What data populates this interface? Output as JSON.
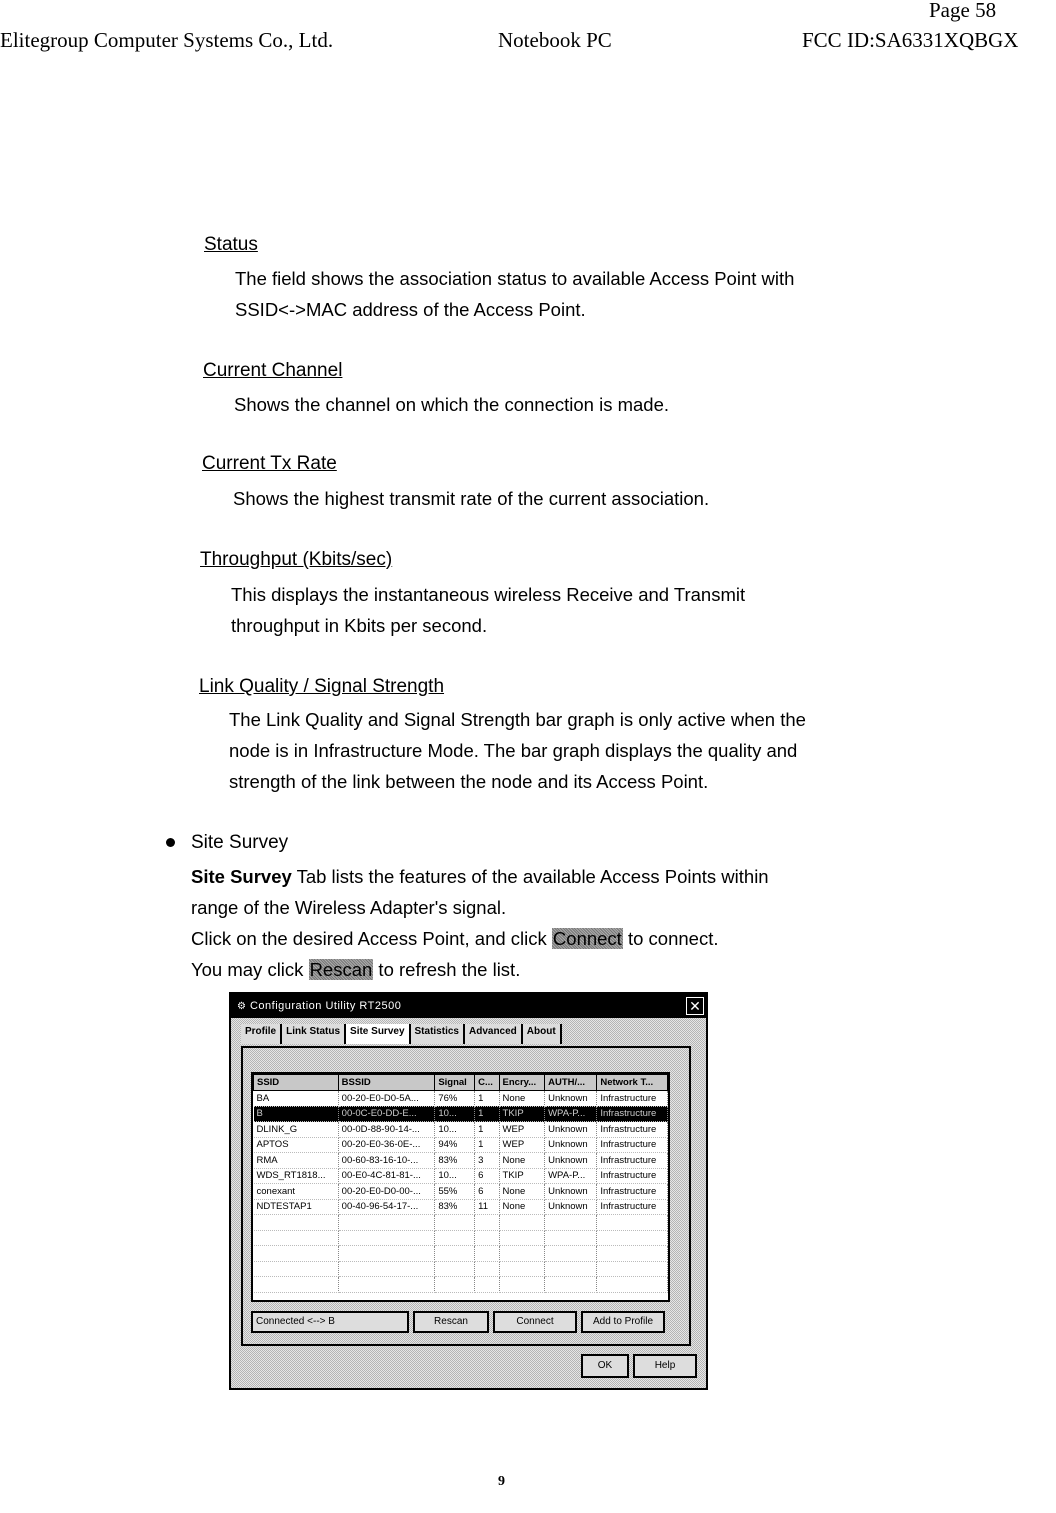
{
  "header": {
    "page_label": "Page 58",
    "company": "Elitegroup Computer Systems Co., Ltd.",
    "product": "Notebook PC",
    "fcc_id": "FCC ID:SA6331XQBGX"
  },
  "sections": [
    {
      "title": "Status",
      "lines": [
        "The field shows the association status to available Access Point with",
        "SSID<->MAC address of the Access Point."
      ]
    },
    {
      "title": "Current Channel",
      "lines": [
        "Shows the channel on which the connection is made."
      ]
    },
    {
      "title": "Current Tx Rate",
      "lines": [
        "Shows the highest transmit rate of the current association."
      ]
    },
    {
      "title": "Throughput (Kbits/sec)",
      "lines": [
        "This displays the instantaneous wireless Receive and Transmit",
        "throughput in Kbits per second."
      ]
    },
    {
      "title": "Link Quality / Signal Strength",
      "lines": [
        "The Link Quality and Signal Strength bar graph is only active when the",
        "node is in Infrastructure Mode. The bar graph displays the quality and",
        "strength of the link between the node and its Access Point."
      ]
    }
  ],
  "site_survey": {
    "title": "Site Survey",
    "bold_lead": "Site Survey",
    "line1_rest": " Tab lists the features of the available Access Points within",
    "line2": "range of the Wireless Adapter's signal.",
    "line3_pre": "Click on the desired Access Point, and click ",
    "connect_chip": "Connect",
    "line3_post": " to connect.",
    "line4_pre": "You may click ",
    "rescan_chip": "Rescan",
    "line4_post": " to refresh the list."
  },
  "dialog": {
    "title": "Configuration Utility RT2500",
    "close_glyph": "✕",
    "tabs": [
      "Profile",
      "Link Status",
      "Site Survey",
      "Statistics",
      "Advanced",
      "About"
    ],
    "active_tab": "Site Survey",
    "columns": [
      "SSID",
      "BSSID",
      "Signal",
      "C...",
      "Encry...",
      "AUTH/...",
      "Network T..."
    ],
    "rows": [
      [
        "BA",
        "00-20-E0-D0-5A...",
        "76%",
        "1",
        "None",
        "Unknown",
        "Infrastructure"
      ],
      [
        "B",
        "00-0C-E0-DD-E...",
        "10...",
        "1",
        "TKIP",
        "WPA-P...",
        "Infrastructure"
      ],
      [
        "DLINK_G",
        "00-0D-88-90-14-...",
        "10...",
        "1",
        "WEP",
        "Unknown",
        "Infrastructure"
      ],
      [
        "APTOS",
        "00-20-E0-36-0E-...",
        "94%",
        "1",
        "WEP",
        "Unknown",
        "Infrastructure"
      ],
      [
        "RMA",
        "00-60-83-16-10-...",
        "83%",
        "3",
        "None",
        "Unknown",
        "Infrastructure"
      ],
      [
        "WDS_RT1818...",
        "00-E0-4C-81-81-...",
        "10...",
        "6",
        "TKIP",
        "WPA-P...",
        "Infrastructure"
      ],
      [
        "conexant",
        "00-20-E0-D0-00-...",
        "55%",
        "6",
        "None",
        "Unknown",
        "Infrastructure"
      ],
      [
        "NDTESTAP1",
        "00-40-96-54-17-...",
        "83%",
        "11",
        "None",
        "Unknown",
        "Infrastructure"
      ]
    ],
    "selected_row": 1,
    "connection_status": "Connected <--> B",
    "buttons": {
      "rescan": "Rescan",
      "connect": "Connect",
      "add_to_profile": "Add to Profile",
      "ok": "OK",
      "help": "Help"
    }
  },
  "footer": {
    "page_number": "9"
  }
}
